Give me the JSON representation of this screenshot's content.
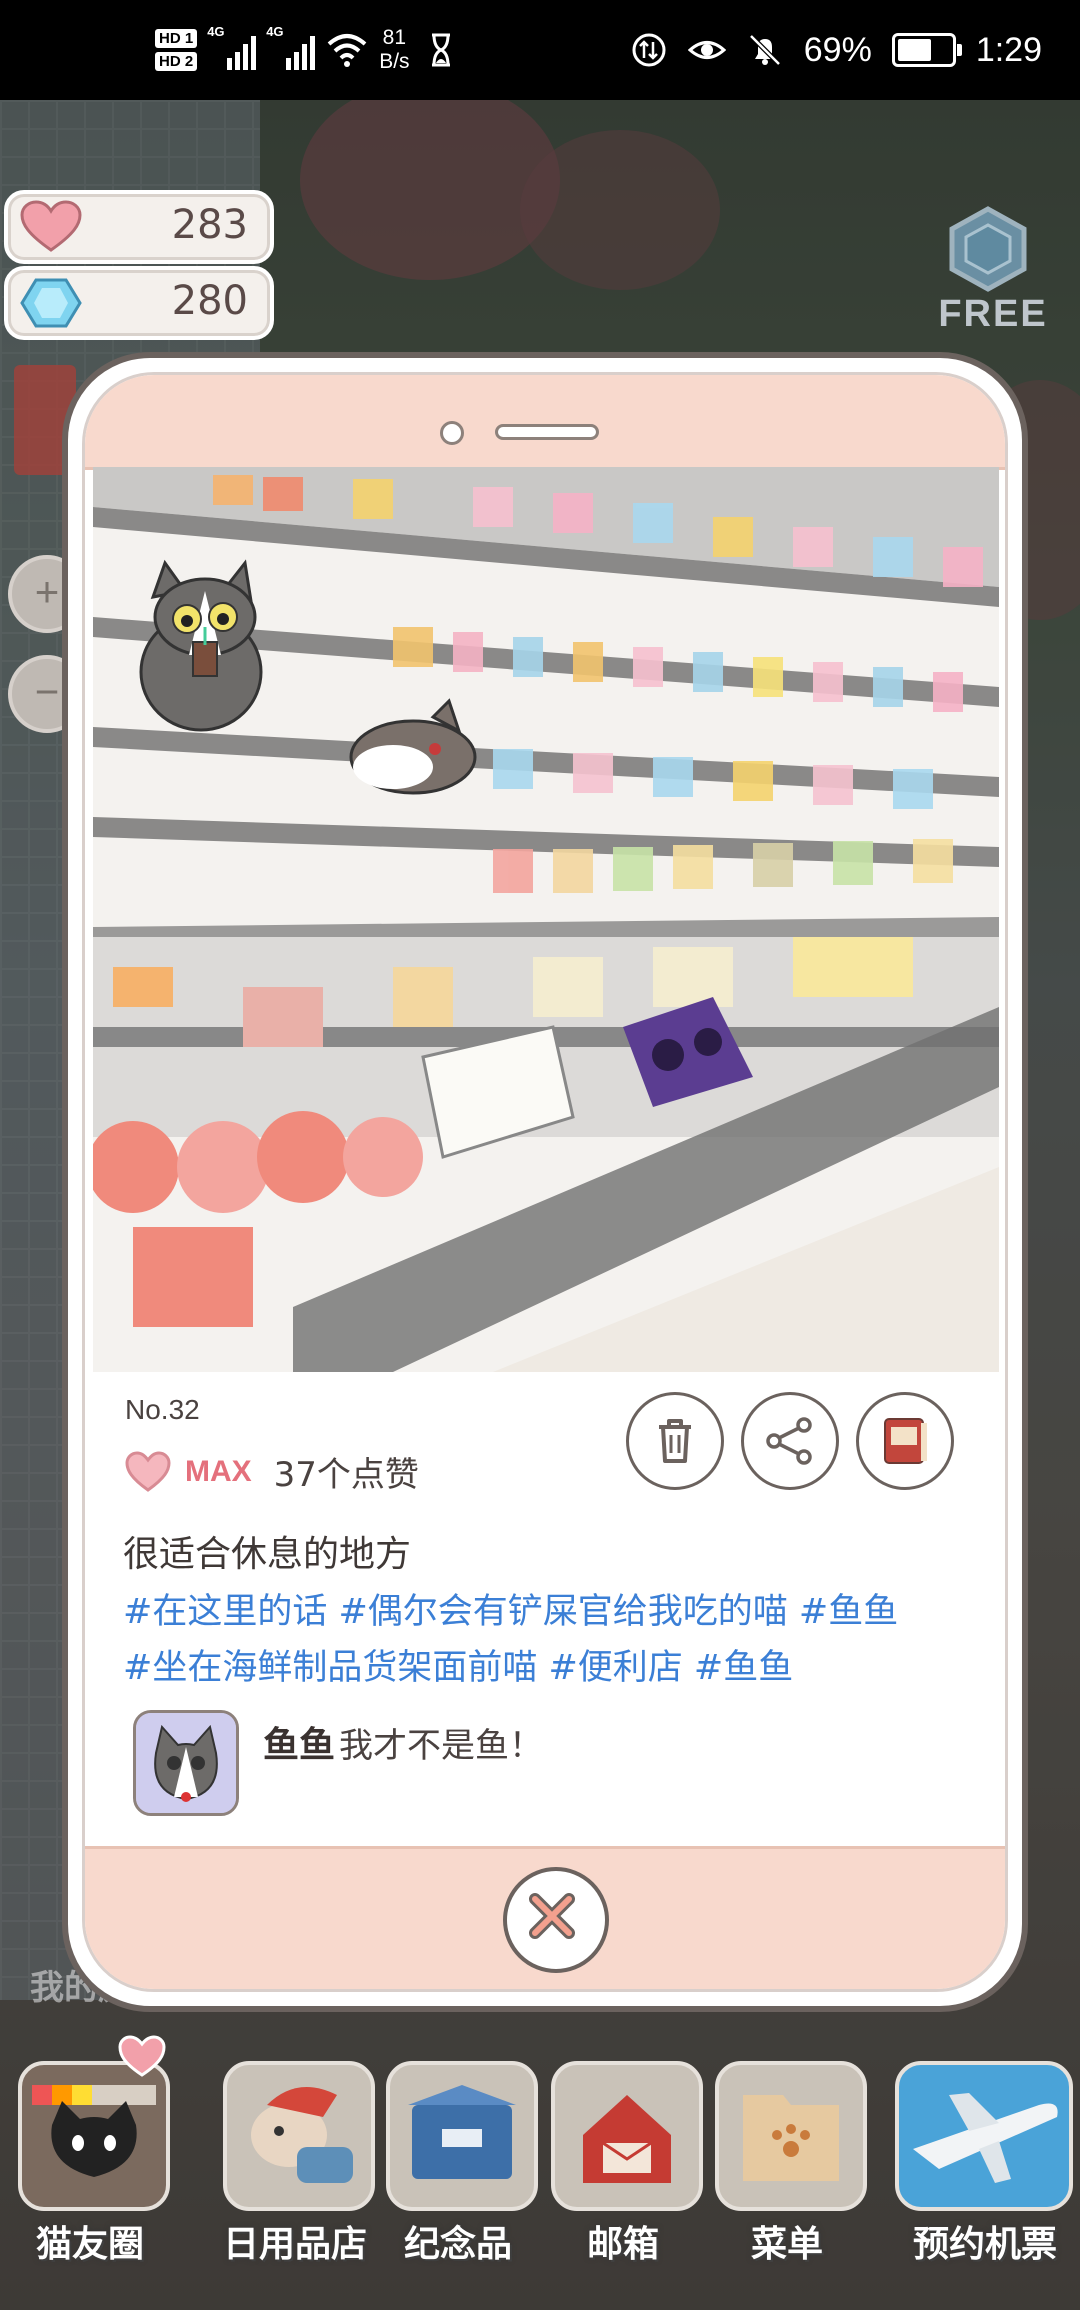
{
  "status_bar": {
    "hd1": "HD 1",
    "hd2": "HD 2",
    "net1": "4G",
    "net2": "4G",
    "speed_value": "81",
    "speed_unit": "B/s",
    "battery": "69%",
    "battery_level": 0.69,
    "time": "1:29"
  },
  "resources": {
    "hearts": "283",
    "gems": "280",
    "free_label": "FREE"
  },
  "zoom": {
    "in": "+",
    "out": "−"
  },
  "post": {
    "number": "No.32",
    "like_level": "MAX",
    "like_count": "37个点赞",
    "caption": "很适合休息的地方",
    "tags_line1": "#在这里的话 #偶尔会有铲屎官给我吃的喵 #鱼鱼",
    "tags_line2": "#坐在海鲜制品货架面前喵 #便利店 #鱼鱼",
    "comment_author": "鱼鱼",
    "comment_text": "我才不是鱼！"
  },
  "background_label": "我的房",
  "nav": [
    {
      "label": "猫友圈",
      "icon": "cat-friends-icon"
    },
    {
      "label": "日用品店",
      "icon": "daily-goods-icon"
    },
    {
      "label": "纪念品",
      "icon": "souvenir-box-icon"
    },
    {
      "label": "邮箱",
      "icon": "mailbox-icon"
    },
    {
      "label": "菜单",
      "icon": "menu-folder-icon"
    },
    {
      "label": "预约机票",
      "icon": "airplane-icon"
    }
  ],
  "colors": {
    "tag_blue": "#3b7fd6",
    "like_pink": "#e4707c",
    "phone_pink": "#f8d9cd"
  }
}
